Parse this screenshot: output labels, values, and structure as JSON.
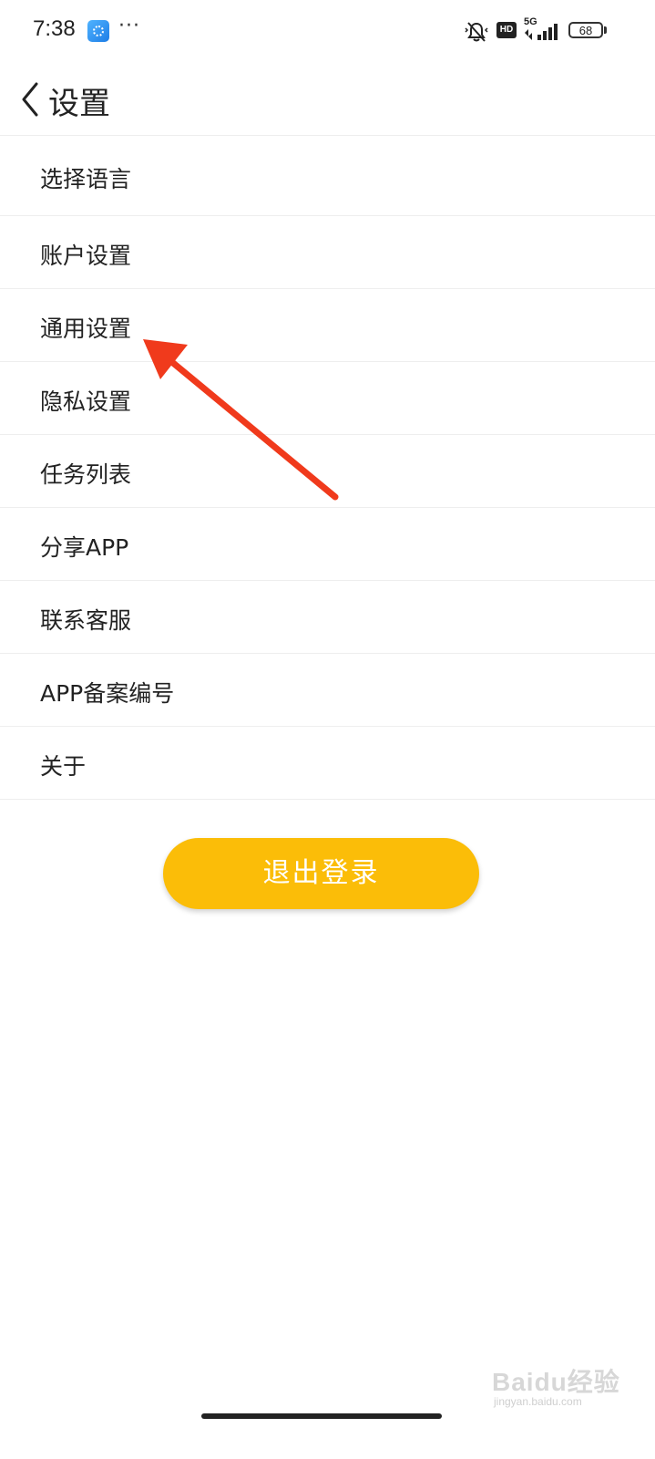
{
  "status_bar": {
    "time": "7:38",
    "more": "···",
    "hd": "HD",
    "network": "5G",
    "battery": "68"
  },
  "header": {
    "back_icon": "chevron-left-icon",
    "title": "设置"
  },
  "menu": {
    "items": [
      {
        "label": "选择语言"
      },
      {
        "label": "账户设置"
      },
      {
        "label": "通用设置"
      },
      {
        "label": "隐私设置"
      },
      {
        "label": "任务列表"
      },
      {
        "label": "分享APP"
      },
      {
        "label": "联系客服"
      },
      {
        "label": "APP备案编号"
      },
      {
        "label": "关于"
      }
    ]
  },
  "logout": {
    "label": "退出登录",
    "color": "#fbbd08"
  },
  "annotation": {
    "arrow_color": "#f03a1c",
    "points_to": "通用设置"
  },
  "watermark": {
    "logo": "Baidu经验",
    "sub": "jingyan.baidu.com"
  }
}
